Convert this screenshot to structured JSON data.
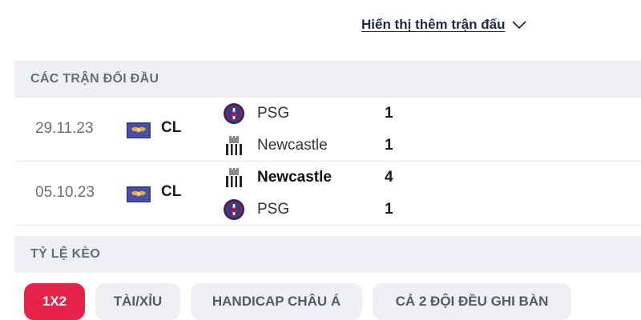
{
  "show_more": {
    "label": "Hiển thị thêm trận đấu",
    "icon": "chevron-down-icon"
  },
  "h2h": {
    "title": "CÁC TRẬN ĐỐI ĐẦU",
    "matches": [
      {
        "date": "29.11.23",
        "competition": "CL",
        "competition_icon": "champions-league-flag-icon",
        "home": {
          "name": "PSG",
          "score": "1",
          "winner": false,
          "badge": "psg-badge-icon"
        },
        "away": {
          "name": "Newcastle",
          "score": "1",
          "winner": false,
          "badge": "newcastle-badge-icon"
        }
      },
      {
        "date": "05.10.23",
        "competition": "CL",
        "competition_icon": "champions-league-flag-icon",
        "home": {
          "name": "Newcastle",
          "score": "4",
          "winner": true,
          "badge": "newcastle-badge-icon"
        },
        "away": {
          "name": "PSG",
          "score": "1",
          "winner": false,
          "badge": "psg-badge-icon"
        }
      }
    ]
  },
  "odds": {
    "title": "TỶ LỆ KÈO",
    "tabs": [
      {
        "label": "1X2",
        "active": true
      },
      {
        "label": "TÀI/XỈU",
        "active": false
      },
      {
        "label": "HANDICAP CHÂU Á",
        "active": false
      },
      {
        "label": "CẢ 2 ĐỘI ĐỀU GHI BÀN",
        "active": false
      }
    ]
  },
  "colors": {
    "accent": "#e8234a",
    "header_bg": "#eef0f4",
    "link": "#1c2a4a"
  }
}
